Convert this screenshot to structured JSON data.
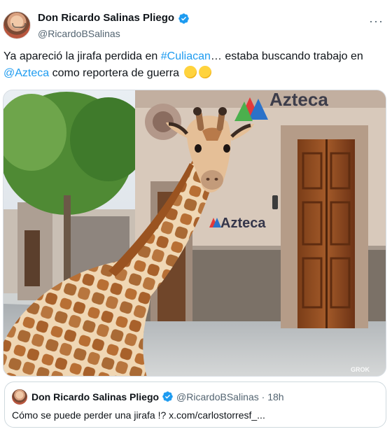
{
  "tweet": {
    "author_name": "Don Ricardo Salinas Pliego",
    "handle": "@RicardoBSalinas",
    "more_label": "···",
    "text_1": "Ya apareció la jirafa perdida en ",
    "hashtag": "#Culiacan",
    "text_2": "… estaba buscando trabajo en",
    "mention": "@Azteca",
    "text_3": " como reportera de guerra",
    "emojis": [
      "face-with-tears-of-joy",
      "zany-face"
    ]
  },
  "media": {
    "sign_top": "Azteca",
    "sign_wall": "Azteca",
    "watermark": "GROK"
  },
  "quote": {
    "author_name": "Don Ricardo Salinas Pliego",
    "handle_time": "@RicardoBSalinas · 18h",
    "text": "Cómo se puede perder una jirafa !? x.com/carlostorresf_..."
  },
  "colors": {
    "link": "#1d9bf0",
    "verified": "#1d9bf0",
    "secondary_text": "#536471"
  }
}
